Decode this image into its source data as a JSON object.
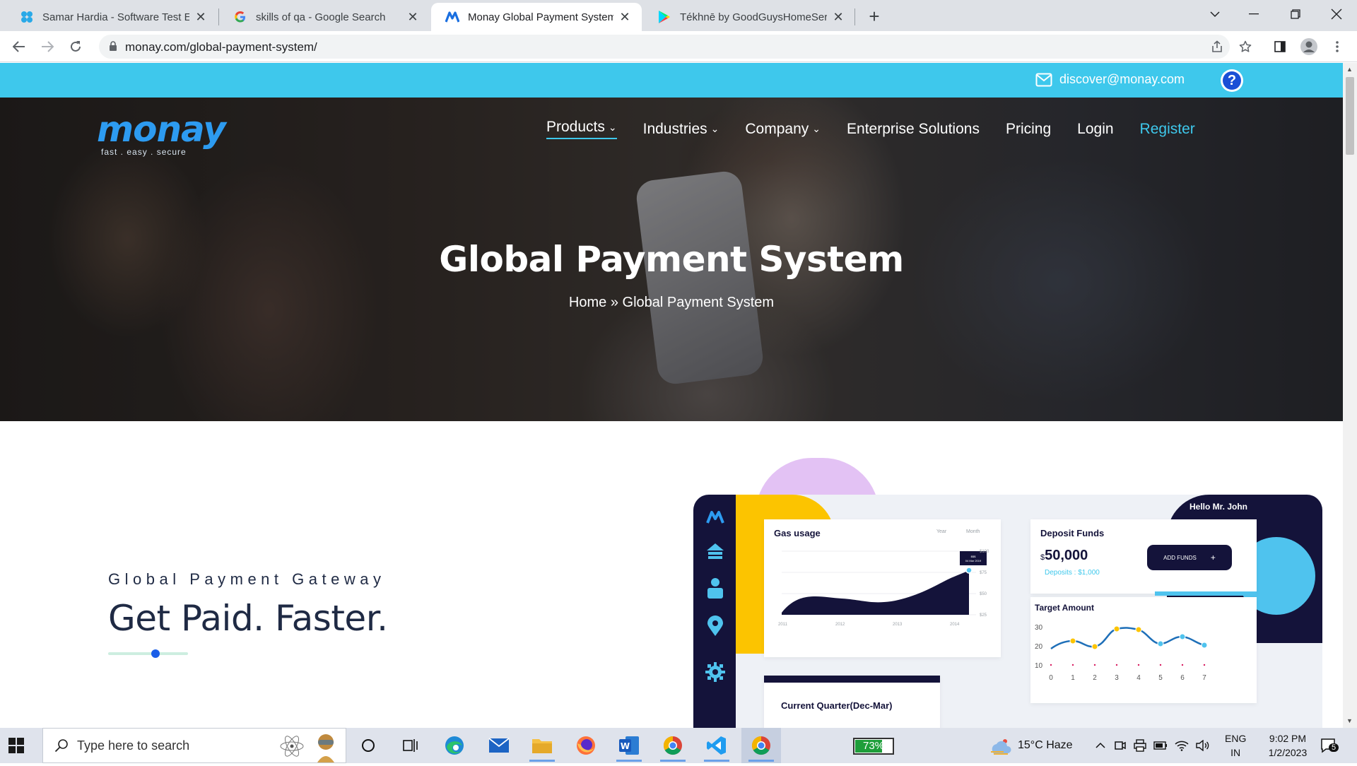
{
  "browser": {
    "tabs": [
      {
        "title": "Samar Hardia - Software Test Eng",
        "favicon": "profile-badge-icon",
        "active": false
      },
      {
        "title": "skills of qa - Google Search",
        "favicon": "google-icon",
        "active": false
      },
      {
        "title": "Monay Global Payment System |",
        "favicon": "monay-icon",
        "active": true
      },
      {
        "title": "Tékhnē by GoodGuysHomeServic",
        "favicon": "play-store-icon",
        "active": false
      }
    ],
    "url": "monay.com/global-payment-system/"
  },
  "site": {
    "topbar": {
      "email": "discover@monay.com",
      "help_label": "?"
    },
    "logo": {
      "word": "monay",
      "tagline": "fast  .  easy  .  secure"
    },
    "nav": [
      {
        "label": "Products",
        "dropdown": true,
        "active": true
      },
      {
        "label": "Industries",
        "dropdown": true,
        "active": false
      },
      {
        "label": "Company",
        "dropdown": true,
        "active": false
      },
      {
        "label": "Enterprise Solutions",
        "dropdown": false,
        "active": false
      },
      {
        "label": "Pricing",
        "dropdown": false,
        "active": false
      },
      {
        "label": "Login",
        "dropdown": false,
        "active": false
      },
      {
        "label": "Register",
        "dropdown": false,
        "active": false
      }
    ],
    "hero": {
      "title": "Global Payment System",
      "breadcrumb_home": "Home",
      "breadcrumb_sep": "»",
      "breadcrumb_current": "Global Payment System"
    },
    "section": {
      "subhead": "Global Payment Gateway",
      "headline": "Get Paid. Faster."
    },
    "dashboard": {
      "greeting": "Hello Mr. John",
      "gas_card": {
        "title": "Gas usage",
        "filters": [
          "Year",
          "Month"
        ],
        "y_ticks": [
          "$100",
          "$75",
          "$50",
          "$25"
        ],
        "x_ticks": [
          "2011",
          "2012",
          "2013",
          "2014"
        ],
        "tooltip": [
          "$$$",
          "04 Mar 2019"
        ]
      },
      "deposit_card": {
        "title": "Deposit Funds",
        "currency": "$",
        "amount": "50,000",
        "sub": "Deposits : $1,000",
        "button": "ADD FUNDS",
        "button_icon": "+"
      },
      "target_card": {
        "title": "Target Amount",
        "y_ticks": [
          "30",
          "20",
          "10"
        ],
        "x_ticks": [
          "0",
          "1",
          "2",
          "3",
          "4",
          "5",
          "6",
          "7"
        ]
      },
      "quarter_card": {
        "title": "Current Quarter(Dec-Mar)"
      }
    }
  },
  "taskbar": {
    "search_placeholder": "Type here to search",
    "battery": "73%",
    "battery_level": 0.73,
    "weather": "15°C  Haze",
    "lang_top": "ENG",
    "lang_bottom": "IN",
    "time": "9:02 PM",
    "date": "1/2/2023",
    "notifications": "5"
  },
  "colors": {
    "accent_cyan": "#3ec8ec",
    "navy": "#14133a",
    "brand_blue": "#2d9bf0",
    "yellow": "#fcc400"
  }
}
